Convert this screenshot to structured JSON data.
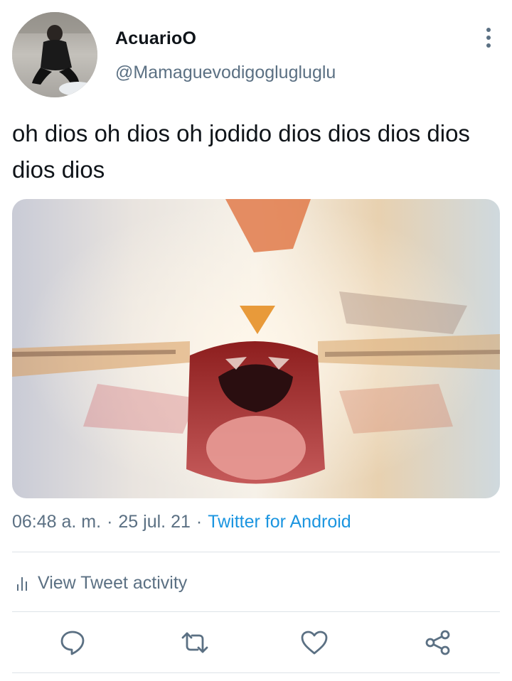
{
  "tweet": {
    "display_name": "AcuarioO",
    "username": "@Mamaguevodigoglugluglu",
    "text": "oh dios oh dios oh jodido dios dios dios dios dios dios",
    "time": "06:48 a. m.",
    "date": "25 jul. 21",
    "separator": "·",
    "source": "Twitter for Android"
  },
  "activity": {
    "label": "View Tweet activity",
    "icon": "bar-chart-icon"
  },
  "actions": [
    {
      "icon": "reply-icon"
    },
    {
      "icon": "retweet-icon"
    },
    {
      "icon": "like-icon"
    },
    {
      "icon": "share-icon"
    }
  ],
  "colors": {
    "text": "#0f1419",
    "secondary": "#5b7083",
    "link": "#1b95e0",
    "divider": "#dde3e8"
  }
}
